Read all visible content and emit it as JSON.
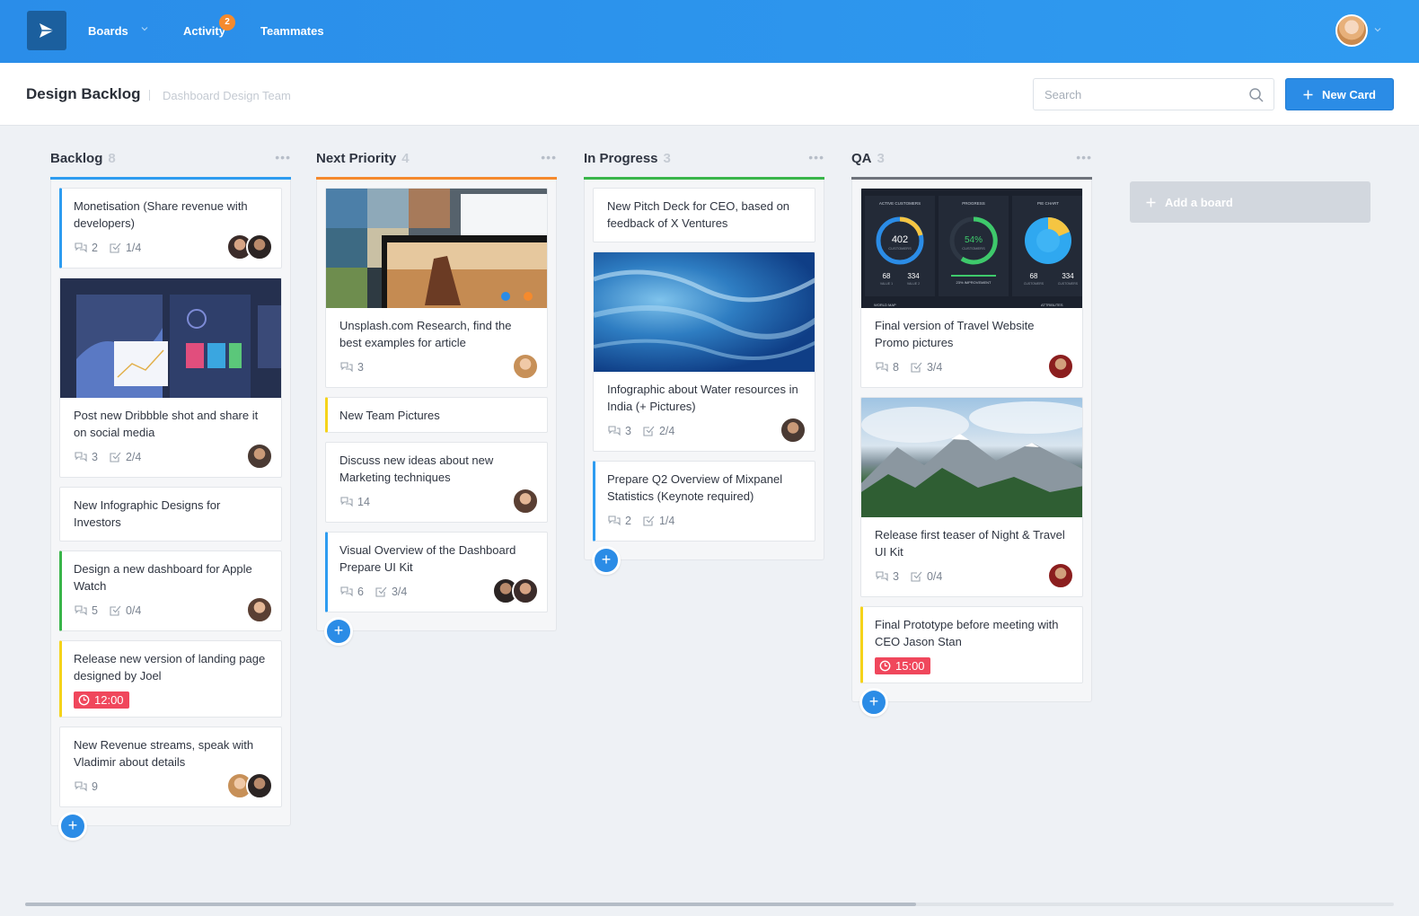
{
  "nav": {
    "boards": "Boards",
    "activity": "Activity",
    "activity_badge": "2",
    "teammates": "Teammates"
  },
  "header": {
    "title": "Design Backlog",
    "team": "Dashboard Design Team",
    "search_placeholder": "Search",
    "new_card": "New Card"
  },
  "add_board": "Add a board",
  "colors": {
    "primary": "#2b8ce6",
    "backlog": "#2e9cf0",
    "next_priority": "#f58a2d",
    "in_progress": "#39b54a",
    "qa": "#6e737b",
    "yellow": "#f5d31a",
    "time_badge": "#f0475c"
  },
  "columns": [
    {
      "title": "Backlog",
      "count": "8",
      "cards": [
        {
          "title": "Monetisation (Share revenue with developers)",
          "comments": "2",
          "checklist": "1/4"
        },
        {
          "title": "Post new Dribbble shot and share it on social media",
          "comments": "3",
          "checklist": "2/4"
        },
        {
          "title": "New Infographic Designs for Investors"
        },
        {
          "title": "Design a new dashboard for Apple Watch",
          "comments": "5",
          "checklist": "0/4"
        },
        {
          "title": "Release new version of landing page designed by Joel",
          "time": "12:00"
        },
        {
          "title": "New Revenue streams, speak with Vladimir about details",
          "comments": "9"
        }
      ]
    },
    {
      "title": "Next Priority",
      "count": "4",
      "cards": [
        {
          "title": "Unsplash.com Research, find the best examples for article",
          "comments": "3"
        },
        {
          "title": "New Team Pictures"
        },
        {
          "title": "Discuss new ideas about new Marketing techniques",
          "comments": "14"
        },
        {
          "title": "Visual Overview of the Dashboard Prepare UI Kit",
          "comments": "6",
          "checklist": "3/4"
        }
      ]
    },
    {
      "title": "In Progress",
      "count": "3",
      "cards": [
        {
          "title": "New Pitch Deck for CEO, based on feedback of X Ventures"
        },
        {
          "title": "Infographic about Water resources in India (+ Pictures)",
          "comments": "3",
          "checklist": "2/4"
        },
        {
          "title": "Prepare Q2 Overview of Mixpanel Statistics (Keynote required)",
          "comments": "2",
          "checklist": "1/4"
        }
      ]
    },
    {
      "title": "QA",
      "count": "3",
      "cards": [
        {
          "title": "Final version of Travel Website Promo pictures",
          "comments": "8",
          "checklist": "3/4"
        },
        {
          "title": "Release first teaser of Night & Travel UI Kit",
          "comments": "3",
          "checklist": "0/4"
        },
        {
          "title": "Final Prototype before meeting with CEO Jason Stan",
          "time": "15:00"
        }
      ]
    }
  ],
  "dashboard_image": {
    "panels": [
      "ACTIVE CUSTOMERS",
      "PROGRESS",
      "PIE CHART"
    ],
    "ring_value": "402",
    "ring_label": "CUSTOMERS",
    "progress_value": "54%",
    "progress_label": "CUSTOMERS",
    "stats_a": [
      "68",
      "334"
    ],
    "stats_a_labels": [
      "VALUE 1",
      "VALUE 2"
    ],
    "improvement": "23% IMPROVEMENT",
    "stats_c": [
      "68",
      "334"
    ],
    "stats_c_labels": [
      "CUSTOMERS",
      "CUSTOMERS"
    ],
    "footer": [
      "WORLD MAP",
      "ATTRIBUTES"
    ]
  }
}
